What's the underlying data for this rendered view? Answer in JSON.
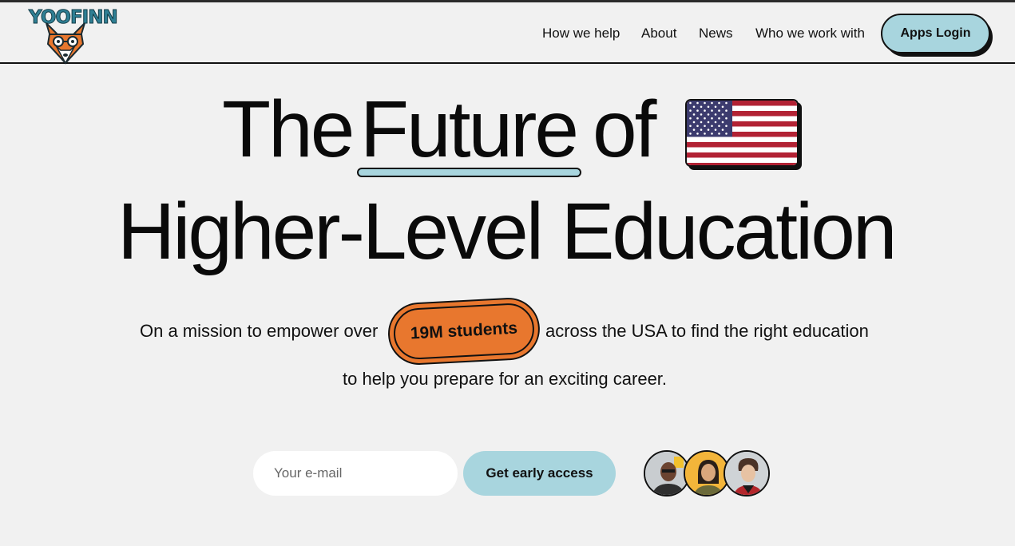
{
  "brand": {
    "logo_text": "YOOFINN"
  },
  "nav": {
    "items": [
      "How we help",
      "About",
      "News",
      "Who we work with"
    ],
    "login_label": "Apps Login"
  },
  "hero": {
    "word_the": "The",
    "word_future": "Future",
    "word_of": "of",
    "line2": "Higher-Level Education",
    "sub_before": "On a mission to empower over",
    "badge": "19M students",
    "sub_after": "across the USA to find the right education",
    "sub_line2": "to help you prepare for an exciting career."
  },
  "signup": {
    "email_placeholder": "Your e-mail",
    "email_value": "",
    "button_label": "Get early access"
  },
  "colors": {
    "background": "#f1f1f1",
    "accent_blue": "#a8d5de",
    "accent_orange": "#e8772e",
    "ink": "#111111"
  },
  "icons": [
    "fox-logo-icon",
    "us-flag-icon"
  ]
}
